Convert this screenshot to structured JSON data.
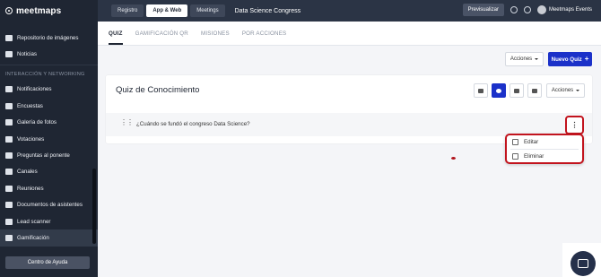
{
  "brand": {
    "logo_text": "meetmaps"
  },
  "sidebar": {
    "items_top": [
      {
        "label": "Repositorio de imágenes",
        "icon": "image-repo-icon"
      },
      {
        "label": "Noticias",
        "icon": "news-icon"
      }
    ],
    "section_label": "INTERACCIÓN Y NETWORKING",
    "items": [
      {
        "label": "Notificaciones",
        "icon": "bell-icon"
      },
      {
        "label": "Encuestas",
        "icon": "survey-icon"
      },
      {
        "label": "Galería de fotos",
        "icon": "gallery-icon"
      },
      {
        "label": "Votaciones",
        "icon": "vote-icon"
      },
      {
        "label": "Preguntas al ponente",
        "icon": "questions-icon"
      },
      {
        "label": "Canales",
        "icon": "channels-icon"
      },
      {
        "label": "Reuniones",
        "icon": "meetings-icon"
      },
      {
        "label": "Documentos de asistentes",
        "icon": "documents-icon"
      },
      {
        "label": "Lead scanner",
        "icon": "scanner-icon"
      },
      {
        "label": "Gamificación",
        "icon": "trophy-icon"
      }
    ],
    "help_label": "Centro de Ayuda"
  },
  "topbar": {
    "tabs": [
      "Registro",
      "App & Web",
      "Meetings"
    ],
    "active_tab": "App & Web",
    "event_name": "Data Science Congress",
    "preview_label": "Previsualizar",
    "user_name": "Meetmaps Events"
  },
  "subtabs": [
    "QUIZ",
    "GAMIFICACIÓN QR",
    "MISIONES",
    "POR ACCIONES"
  ],
  "actions": {
    "acciones_label": "Acciones",
    "new_quiz_label": "Nuevo Quiz"
  },
  "card": {
    "title": "Quiz de Conocimiento",
    "acciones_label": "Acciones",
    "question": "¿Cuándo se fundó el congreso Data Science?"
  },
  "menu": {
    "edit_label": "Editar",
    "delete_label": "Eliminar"
  },
  "colors": {
    "sidebar": "#1f2633",
    "primary": "#1b31c9",
    "highlight": "#c2141e"
  }
}
